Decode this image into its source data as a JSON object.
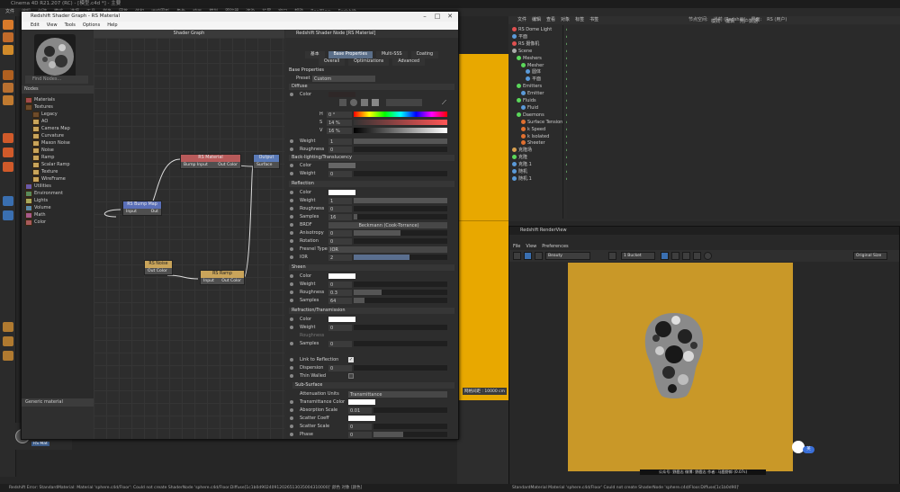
{
  "app": {
    "title": "Cinema 4D R21.207 (RC) - [模型.c4d *] - 主要",
    "main_menu": [
      "文件",
      "编辑",
      "创建",
      "模式",
      "选择",
      "工具",
      "样条",
      "网格",
      "体积",
      "运动图形",
      "角色",
      "动画",
      "模拟",
      "跟踪器",
      "渲染",
      "扩展",
      "窗口",
      "帮助",
      "RealFlow",
      "Redshift"
    ],
    "right_menu": [
      "节点空间:",
      "当前 (Redshift)",
      "界面:",
      "RS (用户)"
    ],
    "status": "Redshift Error: StandardMaterial: Material 'sphere.c4d/Floor': Could not create ShaderNode 'sphere.c4d/Floor.Diffuse[1c1b0d90240912026513035004310000]'  颜色 对象 [颜色]",
    "status_right": "StandardMaterial Material 'sphere.c4d/Floor' Could not create ShaderNode 'sphere.c4d/Floor.Diffuse[1c1b0d90]'",
    "viewport_grid_label": "网格间距 : 10000 cm",
    "material_label": "RS Mat"
  },
  "shader_graph": {
    "window_title": "Redshift Shader Graph - RS Material",
    "menu": [
      "Edit",
      "View",
      "Tools",
      "Options",
      "Help"
    ],
    "find_nodes": "Find Nodes...",
    "nodes_header": "Nodes",
    "graph_header": "Shader Graph",
    "tree": [
      "Materials",
      "Textures",
      "Legacy",
      "AO",
      "Camera Map",
      "Curvature",
      "Maxon Noise",
      "Noise",
      "Ramp",
      "Scalar Ramp",
      "Texture",
      "WireFrame",
      "Utilities",
      "Environment",
      "Lights",
      "Volume",
      "Math",
      "Color"
    ],
    "generic_material": "Generic material",
    "nodes": {
      "material": {
        "title": "RS Material",
        "in": "Bump Input",
        "out": "Out Color"
      },
      "output": {
        "title": "Output",
        "in": "Surface"
      },
      "bump": {
        "title": "RS Bump Map",
        "in": "Input",
        "out": "Out"
      },
      "noise": {
        "title": "RS Noise",
        "out": "Out Color"
      },
      "ramp": {
        "title": "RS Ramp",
        "in": "Input",
        "out": "Out Color"
      }
    }
  },
  "properties": {
    "header": "Redshift Shader Node [RS Material]",
    "tabs_row1": [
      "基本",
      "Base Properties",
      "Multi-SSS",
      "Coating"
    ],
    "tabs_row2": [
      "Overall",
      "Optimizations",
      "Advanced"
    ],
    "base_properties": "Base Properties",
    "preset_label": "Preset",
    "preset_value": "Custom",
    "sections": {
      "diffuse": "Diffuse",
      "back": "Back-lighting/Translucency",
      "reflection": "Reflection",
      "sheen": "Sheen",
      "refraction": "Refraction/Transmission",
      "subsurface": "Sub-Surface"
    },
    "diffuse": {
      "color": "Color",
      "h": "H",
      "h_val": "0 °",
      "s": "S",
      "s_val": "14 %",
      "v": "V",
      "v_val": "16 %",
      "weight": "Weight",
      "weight_val": "1",
      "roughness": "Roughness",
      "roughness_val": "0"
    },
    "back": {
      "color": "Color",
      "weight": "Weight",
      "weight_val": "0"
    },
    "reflection": {
      "color": "Color",
      "weight": "Weight",
      "weight_val": "1",
      "roughness": "Roughness",
      "roughness_val": "0",
      "samples": "Samples",
      "samples_val": "16",
      "brdf": "BRDF",
      "brdf_val": "Beckmann (Cook-Torrance)",
      "anisotropy": "Anisotropy",
      "anisotropy_val": "0",
      "rotation": "Rotation",
      "rotation_val": "0",
      "fresnel": "Fresnel Type",
      "fresnel_val": "IOR",
      "ior": "IOR",
      "ior_val": "2"
    },
    "sheen": {
      "color": "Color",
      "weight": "Weight",
      "weight_val": "0",
      "roughness": "Roughness",
      "roughness_val": "0.3",
      "samples": "Samples",
      "samples_val": "64"
    },
    "refraction": {
      "color": "Color",
      "weight": "Weight",
      "weight_val": "0",
      "roughness": "Roughness",
      "samples": "Samples",
      "samples_val": "0",
      "link": "Link to Reflection",
      "dispersion": "Dispersion",
      "dispersion_val": "0",
      "thin": "Thin Walled"
    },
    "subsurface": {
      "atten_units": "Attenuation Units",
      "atten_units_val": "Transmittance",
      "trans_color": "Transmittance Color",
      "abs_scale": "Absorption Scale",
      "abs_scale_val": "0.01",
      "scatter_coeff": "Scatter Coeff",
      "scatter_scale": "Scatter Scale",
      "scatter_scale_val": "0",
      "phase": "Phase",
      "phase_val": "0"
    }
  },
  "objects": {
    "menu": [
      "文件",
      "编辑",
      "查看",
      "对象",
      "标签",
      "书签"
    ],
    "items": [
      {
        "name": "RS Dome Light",
        "color": "#e05050"
      },
      {
        "name": "平面",
        "color": "#5b9ad8"
      },
      {
        "name": "RS 摄像机",
        "color": "#e05050"
      },
      {
        "name": "Scene",
        "color": "#aaaaaa"
      },
      {
        "name": "Meshers",
        "color": "#5bd85b"
      },
      {
        "name": "Mesher",
        "color": "#5bd85b"
      },
      {
        "name": "圆体",
        "color": "#5b9ad8"
      },
      {
        "name": "平面",
        "color": "#5b9ad8"
      },
      {
        "name": "Emitters",
        "color": "#5bd85b"
      },
      {
        "name": "Emitter",
        "color": "#5b9ad8"
      },
      {
        "name": "Fluids",
        "color": "#5bd85b"
      },
      {
        "name": "Fluid",
        "color": "#5b9ad8"
      },
      {
        "name": "Daemons",
        "color": "#5bd85b"
      },
      {
        "name": "Surface Tension",
        "color": "#e07030"
      },
      {
        "name": "k Speed",
        "color": "#e07030"
      },
      {
        "name": "k Isolated",
        "color": "#e07030"
      },
      {
        "name": "Sheeter",
        "color": "#e07030"
      },
      {
        "name": "克隆场",
        "color": "#d8a050"
      },
      {
        "name": "克隆",
        "color": "#5bd85b"
      },
      {
        "name": "克隆.1",
        "color": "#5b9ad8"
      },
      {
        "name": "随机",
        "color": "#5b9ad8"
      },
      {
        "name": "随机.1",
        "color": "#5b9ad8"
      }
    ],
    "right_menu": [
      "模式",
      "编辑",
      "用户数据"
    ]
  },
  "render_view": {
    "title": "Redshift RenderView",
    "menu": [
      "File",
      "View",
      "Preferences"
    ],
    "beauty": "Beauty",
    "bucket": "1 Bucket",
    "zoom": "Original Size",
    "caption": "公众号: 野鹿志   微博: 野鹿志   作者: 马鹿野郎   (0.07s)"
  }
}
